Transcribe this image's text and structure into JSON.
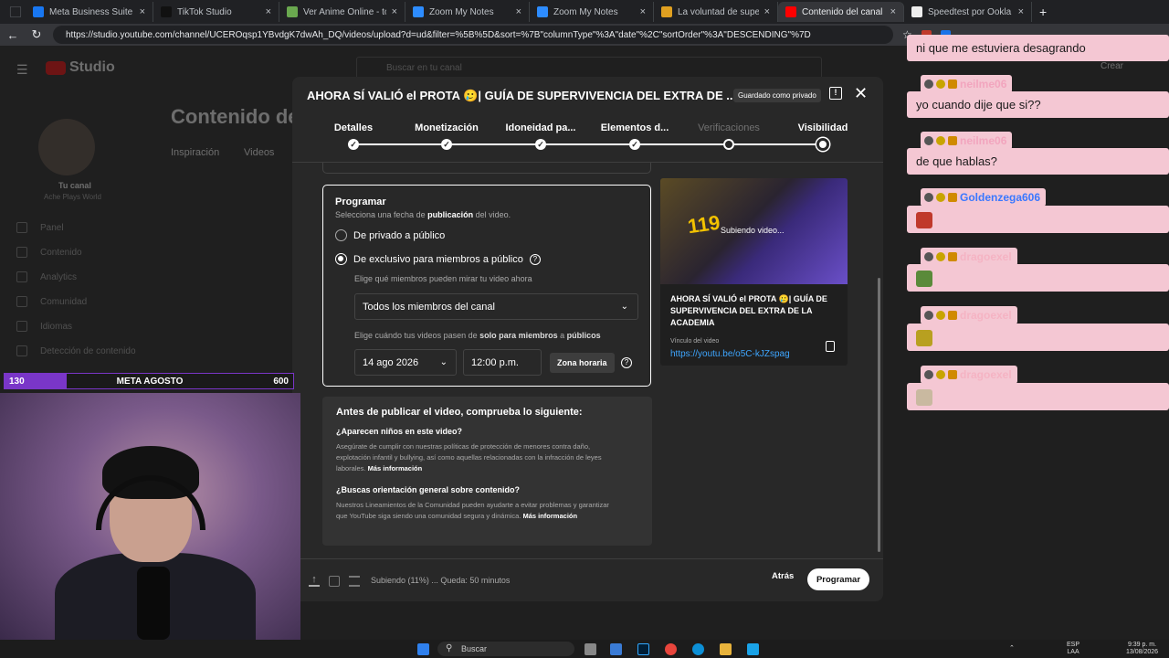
{
  "browser": {
    "tabs": [
      {
        "label": "Meta Business Suite",
        "color": "#1877f2"
      },
      {
        "label": "TikTok Studio",
        "color": "#111111"
      },
      {
        "label": "Ver Anime Online - todos lo",
        "color": "#6aa84f"
      },
      {
        "label": "Zoom My Notes",
        "color": "#2d8cff"
      },
      {
        "label": "Zoom My Notes",
        "color": "#2d8cff"
      },
      {
        "label": "La voluntad de supervivencia",
        "color": "#e0a020"
      },
      {
        "label": "Contenido del canal - YouTu",
        "color": "#ff0000"
      },
      {
        "label": "Speedtest por Ookla - La pr",
        "color": "#eeeeee"
      }
    ],
    "url": "https://studio.youtube.com/channel/UCEROqsp1YBvdgK7dwAh_DQ/videos/upload?d=ud&filter=%5B%5D&sort=%7B\"columnType\"%3A\"date\"%2C\"sortOrder\"%3A\"DESCENDING\"%7D",
    "verify_label": "Verifique que es usted",
    "chat_label": "Chat"
  },
  "studio_bg": {
    "logo_text": "Studio",
    "search_placeholder": "Buscar en tu canal",
    "create_label": "Crear",
    "page_title": "Contenido del",
    "tabs": [
      "Inspiración",
      "Videos"
    ],
    "channel_label": "Tu canal",
    "channel_name": "Ache Plays World",
    "sidebar": [
      "Panel",
      "Contenido",
      "Analytics",
      "Comunidad",
      "Idiomas",
      "Detección de contenido"
    ]
  },
  "modal": {
    "title": "AHORA SÍ VALIÓ el PROTA 🥲| GUÍA DE SUPERVIVENCIA DEL EXTRA DE ...",
    "saved_badge": "Guardado como privado",
    "steps": [
      {
        "label": "Detalles",
        "state": "done"
      },
      {
        "label": "Monetización",
        "state": "done"
      },
      {
        "label": "Idoneidad pa...",
        "state": "done"
      },
      {
        "label": "Elementos d...",
        "state": "done"
      },
      {
        "label": "Verificaciones",
        "state": "muted"
      },
      {
        "label": "Visibilidad",
        "state": "current"
      }
    ],
    "schedule": {
      "heading": "Programar",
      "subtitle_pre": "Selecciona una fecha de ",
      "subtitle_bold": "publicación",
      "subtitle_post": " del video.",
      "option_private": "De privado a público",
      "option_members": "De exclusivo para miembros a público",
      "members_note": "Elige qué miembros pueden mirar tu video ahora",
      "members_select": "Todos los miembros del canal",
      "when_pre": "Elige cuándo tus videos pasen de ",
      "when_bold1": "solo para miembros",
      "when_mid": " a ",
      "when_bold2": "públicos",
      "date": "14 ago 2026",
      "time": "12:00 p.m.",
      "timezone": "Zona horaria"
    },
    "checks": {
      "heading": "Antes de publicar el video, comprueba lo siguiente:",
      "q1": "¿Aparecen niños en este video?",
      "p1": "Asegúrate de cumplir con nuestras políticas de protección de menores contra daño, explotación infantil y bullying, así como aquellas relacionadas con la infracción de leyes laborales.",
      "more1": "Más información",
      "q2": "¿Buscas orientación general sobre contenido?",
      "p2": "Nuestros Lineamientos de la Comunidad pueden ayudarte a evitar problemas y garantizar que YouTube siga siendo una comunidad segura y dinámica.",
      "more2": "Más información"
    },
    "preview": {
      "thumb_text": "119",
      "uploading": "Subiendo video...",
      "title": "AHORA SÍ VALIÓ el PROTA 🥲| GUÍA DE SUPERVIVENCIA DEL EXTRA DE LA ACADEMIA",
      "link_label": "Vínculo del video",
      "link": "https://youtu.be/o5C-kJZspag"
    },
    "footer": {
      "status": "Subiendo (11%) ... Queda: 50 minutos",
      "back": "Atrás",
      "schedule_btn": "Programar"
    }
  },
  "chat": {
    "messages": [
      {
        "type": "text",
        "text": "ni que me estuviera desagrando"
      },
      {
        "type": "author",
        "name": "neilme06",
        "color": "#f2a5be"
      },
      {
        "type": "text",
        "text": "yo cuando dije que si??"
      },
      {
        "type": "author",
        "name": "neilme06",
        "color": "#f2a5be"
      },
      {
        "type": "text",
        "text": "de que hablas?"
      },
      {
        "type": "author",
        "name": "Goldenzega606",
        "color": "#3a78ff"
      },
      {
        "type": "emote",
        "color": "#c0392b"
      },
      {
        "type": "author",
        "name": "dragoexel",
        "color": "#f5b3c3"
      },
      {
        "type": "emote",
        "color": "#5a8a3a"
      },
      {
        "type": "author",
        "name": "dragoexel",
        "color": "#f5b3c3"
      },
      {
        "type": "emote",
        "color": "#b8a020"
      },
      {
        "type": "author",
        "name": "dragoexel",
        "color": "#f5b3c3"
      },
      {
        "type": "emote",
        "color": "#c9b9a0"
      }
    ]
  },
  "goal": {
    "current": "130",
    "label": "META AGOSTO",
    "target": "600",
    "progress": 0.2167
  },
  "taskbar": {
    "search": "Buscar",
    "lang": "ESP",
    "lang2": "LAA",
    "time": "9:39 p. m.",
    "date": "13/08/2026"
  }
}
